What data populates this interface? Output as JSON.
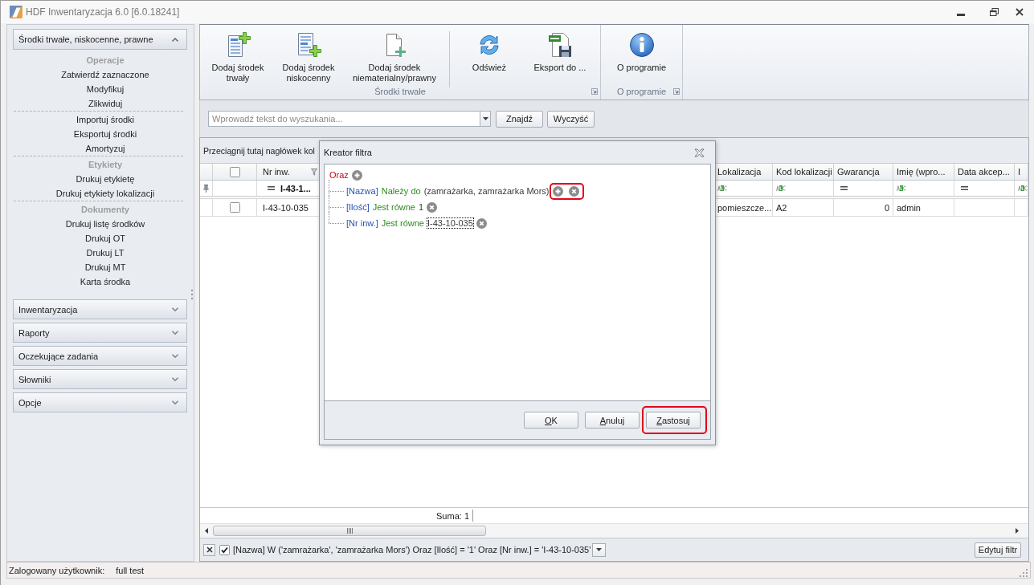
{
  "window": {
    "title": "HDF Inwentaryzacja 6.0 [6.0.18241]"
  },
  "sidebar": {
    "groups": [
      {
        "label": "Środki trwałe, niskocenne, prawne",
        "expanded": true,
        "sections": [
          {
            "heading": "Operacje",
            "items": [
              "Zatwierdź zaznaczone",
              "Modyfikuj",
              "Zlikwiduj"
            ]
          },
          {
            "items": [
              "Importuj środki",
              "Eksportuj środki",
              "Amortyzuj"
            ]
          },
          {
            "heading": "Etykiety",
            "items": [
              "Drukuj etykietę",
              "Drukuj etykiety lokalizacji"
            ]
          },
          {
            "heading": "Dokumenty",
            "items": [
              "Drukuj listę środków",
              "Drukuj OT",
              "Drukuj LT",
              "Drukuj MT",
              "Karta środka"
            ]
          }
        ]
      },
      {
        "label": "Inwentaryzacja",
        "expanded": false
      },
      {
        "label": "Raporty",
        "expanded": false
      },
      {
        "label": "Oczekujące zadania",
        "expanded": false
      },
      {
        "label": "Słowniki",
        "expanded": false
      },
      {
        "label": "Opcje",
        "expanded": false
      }
    ]
  },
  "ribbon": {
    "groups": [
      {
        "label": "Środki trwałe",
        "button_sets": [
          [
            "Dodaj środek\ntrwały",
            "Dodaj środek\nniskocenny",
            "Dodaj środek\nniematerialny/prawny"
          ],
          [
            "Odśwież",
            "Eksport do ..."
          ]
        ]
      },
      {
        "label": "O programie",
        "button_sets": [
          [
            "O programie"
          ]
        ]
      }
    ]
  },
  "search": {
    "placeholder": "Wprowadź tekst do wyszukania...",
    "buttons": [
      "Znajdź",
      "Wyczyść"
    ]
  },
  "grid": {
    "group_panel_hint": "Przeciągnij tutaj nagłówek kol",
    "select_all": {
      "checked": false
    },
    "columns": [
      {
        "label": "Nr inw.",
        "kind": "text",
        "filtered": true,
        "filter_value": "I-43-1..."
      },
      {
        "label": "Lokalizacja",
        "kind": "text",
        "filtered": false
      },
      {
        "label": "Kod lokalizacji",
        "kind": "text",
        "filtered": false
      },
      {
        "label": "Gwarancja",
        "kind": "number",
        "filtered": false
      },
      {
        "label": "Imię (wpro...",
        "kind": "text",
        "filtered": false
      },
      {
        "label": "Data akcep...",
        "kind": "date",
        "filtered": false
      },
      {
        "label": "I",
        "kind": "text",
        "filtered": false
      }
    ],
    "rows": [
      {
        "checked": false,
        "cells": [
          "I-43-10-035",
          "pomieszcze...",
          "A2",
          "0",
          "admin"
        ]
      }
    ],
    "summary": "Suma: 1",
    "filter_panel": {
      "enabled": true,
      "text": "[Nazwa] W ('zamrażarka', 'zamrażarka Mors') Oraz [Ilość] = '1' Oraz [Nr inw.] = 'I-43-10-035'",
      "edit_button": "Edytuj filtr"
    }
  },
  "filter_dialog": {
    "title": "Kreator filtra",
    "root": {
      "operator": "Oraz",
      "conditions": [
        {
          "field": "[Nazwa]",
          "operation": "Należy do",
          "value": "(zamrażarka, zamrażarka Mors)",
          "hovered": true,
          "focused": false,
          "highlighted": true
        },
        {
          "field": "[Ilość]",
          "operation": "Jest równe",
          "value": "1",
          "hovered": false,
          "focused": false,
          "highlighted": false
        },
        {
          "field": "[Nr inw.]",
          "operation": "Jest równe",
          "value": "I-43-10-035",
          "hovered": false,
          "focused": true,
          "highlighted": false
        }
      ]
    },
    "buttons": [
      {
        "label": "OK",
        "mnemonic": true,
        "highlighted": false
      },
      {
        "label": "Anuluj",
        "mnemonic": true,
        "highlighted": false
      },
      {
        "label": "Zastosuj",
        "mnemonic": true,
        "highlighted": true
      }
    ]
  },
  "status_bar": {
    "label": "Zalogowany użytkownik:",
    "user": "full test"
  }
}
